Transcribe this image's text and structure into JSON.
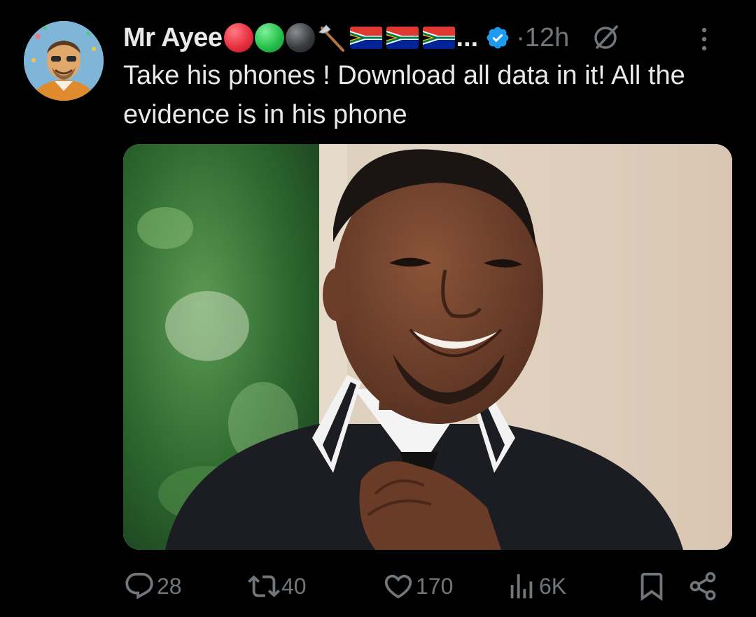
{
  "tweet": {
    "author": {
      "display_name": "Mr Ayee",
      "name_emoji_icons": [
        "red-circle-icon",
        "green-circle-icon",
        "black-circle-icon",
        "axe-icon",
        "south-africa-flag-icon",
        "south-africa-flag-icon",
        "south-africa-flag-icon"
      ],
      "truncation": "...",
      "verified": true
    },
    "time": "12h",
    "separator": "·",
    "text": "Take his phones ! Download all data in it!  All the evidence is in his phone",
    "actions": {
      "replies": "28",
      "reposts": "40",
      "likes": "170",
      "views": "6K"
    }
  },
  "colors": {
    "background": "#000000",
    "text": "#e7e9ea",
    "muted": "#71767b",
    "verified_blue": "#1d9bf0",
    "red_circle": "#e8303f",
    "green_circle": "#27c14c",
    "black_circle": "#333639"
  }
}
